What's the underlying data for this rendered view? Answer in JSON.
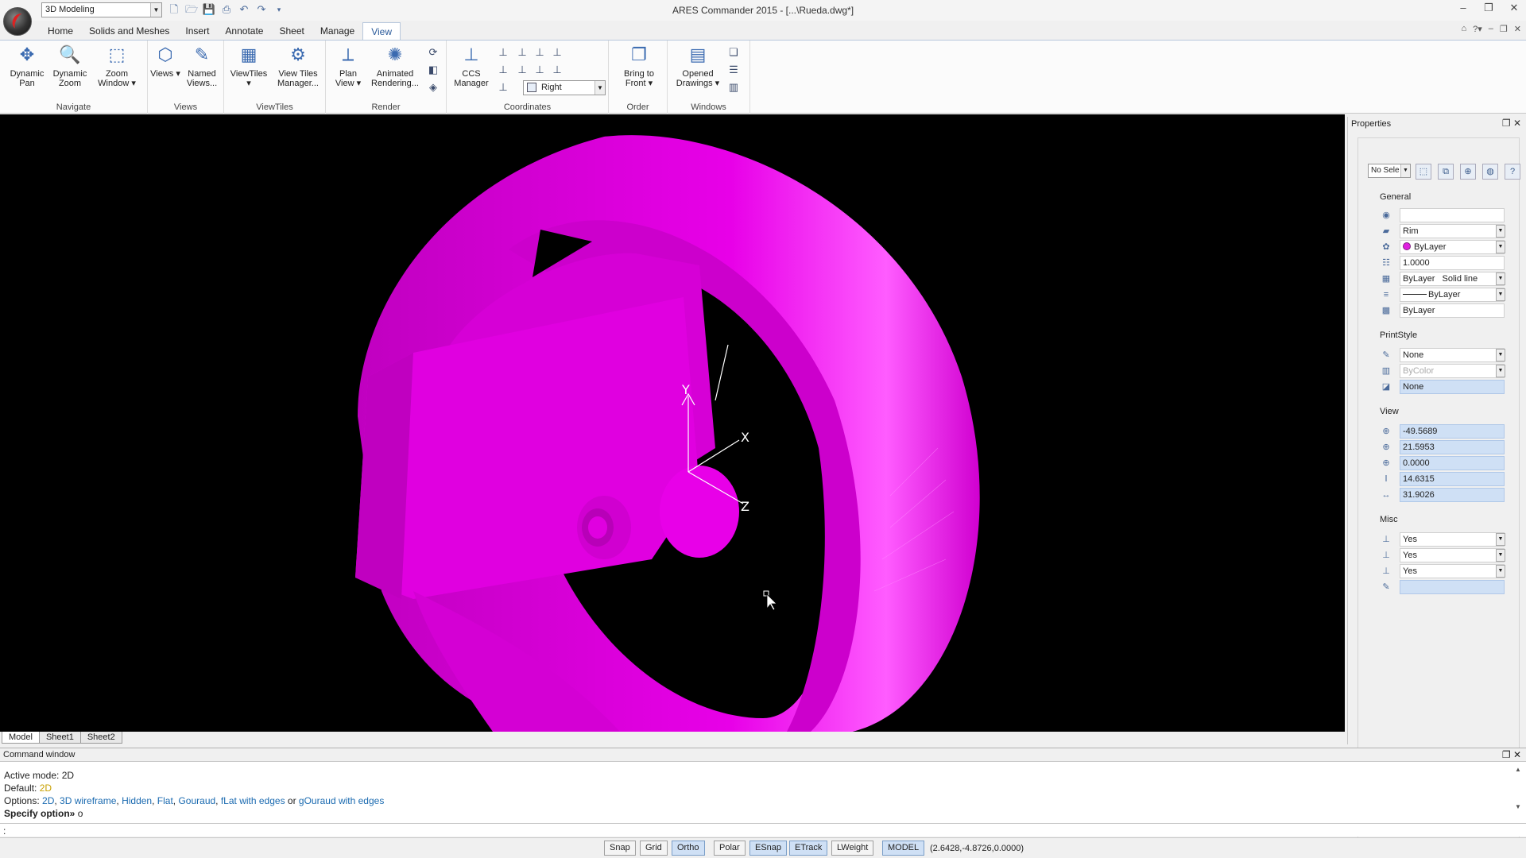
{
  "app": {
    "window_title": "ARES Commander 2015 - [...\\Rueda.dwg*]",
    "workspace": "3D Modeling"
  },
  "ribbon": {
    "tabs": [
      {
        "label": "Home"
      },
      {
        "label": "Solids and Meshes"
      },
      {
        "label": "Insert"
      },
      {
        "label": "Annotate"
      },
      {
        "label": "Sheet"
      },
      {
        "label": "Manage"
      },
      {
        "label": "View"
      }
    ],
    "active_tab": "View",
    "groups": {
      "navigate": {
        "label": "Navigate",
        "buttons": [
          {
            "label": "Dynamic Pan"
          },
          {
            "label": "Dynamic Zoom"
          },
          {
            "label": "Zoom Window ▾"
          }
        ]
      },
      "views": {
        "label": "Views",
        "buttons": [
          {
            "label": "Views ▾"
          },
          {
            "label": "Named Views..."
          }
        ]
      },
      "viewtiles": {
        "label": "ViewTiles",
        "buttons": [
          {
            "label": "ViewTiles ▾"
          },
          {
            "label": "View Tiles Manager..."
          }
        ]
      },
      "render": {
        "label": "Render",
        "buttons": [
          {
            "label": "Plan View ▾"
          },
          {
            "label": "Animated Rendering..."
          }
        ]
      },
      "coordinates": {
        "label": "Coordinates",
        "buttons": [
          {
            "label": "CCS Manager"
          }
        ],
        "ucs_select": "Right"
      },
      "order": {
        "label": "Order",
        "buttons": [
          {
            "label": "Bring to Front ▾"
          }
        ]
      },
      "windows": {
        "label": "Windows",
        "buttons": [
          {
            "label": "Opened Drawings ▾"
          }
        ]
      }
    }
  },
  "viewport": {
    "axis_labels": {
      "x": "X",
      "y": "Y",
      "z": "Z"
    },
    "model_color": "#e600e6",
    "background": "#000000"
  },
  "layout_tabs": [
    {
      "label": "Model",
      "active": true
    },
    {
      "label": "Sheet1",
      "active": false
    },
    {
      "label": "Sheet2",
      "active": false
    }
  ],
  "properties": {
    "title": "Properties",
    "selection": "No Sele",
    "sections": {
      "general": {
        "title": "General",
        "rows": [
          {
            "value": ""
          },
          {
            "value": "Rim"
          },
          {
            "value": "ByLayer"
          },
          {
            "value": "1.0000"
          },
          {
            "value": "ByLayer",
            "extra": "Solid line"
          },
          {
            "value": "ByLayer"
          },
          {
            "value": "ByLayer"
          }
        ]
      },
      "printstyle": {
        "title": "PrintStyle",
        "rows": [
          {
            "value": "None"
          },
          {
            "value": "ByColor"
          },
          {
            "value": "None"
          }
        ]
      },
      "view": {
        "title": "View",
        "rows": [
          {
            "value": "-49.5689"
          },
          {
            "value": "21.5953"
          },
          {
            "value": "0.0000"
          },
          {
            "value": "14.6315"
          },
          {
            "value": "31.9026"
          }
        ]
      },
      "misc": {
        "title": "Misc",
        "rows": [
          {
            "value": "Yes"
          },
          {
            "value": "Yes"
          },
          {
            "value": "Yes"
          },
          {
            "value": ""
          }
        ]
      }
    }
  },
  "command_window": {
    "title": "Command window",
    "lines": {
      "active_mode_label": "Active mode: ",
      "active_mode_value": "2D",
      "default_label": "Default: ",
      "default_value": "2D",
      "options_label": "Options: ",
      "options": [
        "2D",
        "3D wireframe",
        "Hidden",
        "Flat",
        "Gouraud",
        "fLat with edges"
      ],
      "options_or": "or",
      "options_last": "gOuraud with edges",
      "prompt_label": "Specify option»",
      "prompt_value": "o"
    },
    "input": ":"
  },
  "statusbar": {
    "buttons": [
      {
        "label": "Snap",
        "on": false
      },
      {
        "label": "Grid",
        "on": false
      },
      {
        "label": "Ortho",
        "on": true
      },
      {
        "label": "Polar",
        "on": false
      },
      {
        "label": "ESnap",
        "on": true
      },
      {
        "label": "ETrack",
        "on": true
      },
      {
        "label": "LWeight",
        "on": false
      },
      {
        "label": "MODEL",
        "on": true
      }
    ],
    "coordinates": "(2.6428,-4.8726,0.0000)"
  }
}
